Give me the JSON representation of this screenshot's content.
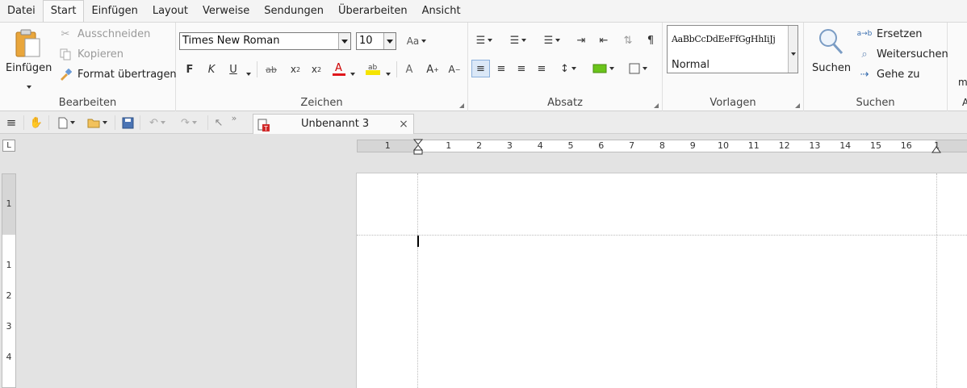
{
  "menu": {
    "items": [
      "Datei",
      "Start",
      "Einfügen",
      "Layout",
      "Verweise",
      "Sendungen",
      "Überarbeiten",
      "Ansicht"
    ],
    "active": "Start"
  },
  "clipboard": {
    "group_label": "Bearbeiten",
    "paste_label": "Einfügen",
    "cut_label": "Ausschneiden",
    "copy_label": "Kopieren",
    "format_painter_label": "Format übertragen"
  },
  "font": {
    "group_label": "Zeichen",
    "font_name": "Times New Roman",
    "font_size": "10",
    "bold_label": "F",
    "italic_label": "K",
    "underline_label": "U"
  },
  "paragraph": {
    "group_label": "Absatz"
  },
  "styles": {
    "group_label": "Vorlagen",
    "preview_text": "AaBbCcDdEeFfGgHhIiJj",
    "current_style": "Normal"
  },
  "search": {
    "group_label": "Suchen",
    "search_label": "Suchen",
    "replace_label": "Ersetzen",
    "find_next_label": "Weitersuchen",
    "goto_label": "Gehe zu",
    "replace_icon_text": "a→b"
  },
  "overflow": {
    "text_1": "m",
    "text_2": "A"
  },
  "document_tab": {
    "title": "Unbenannt 3"
  },
  "ruler": {
    "h_numbers": [
      "1",
      "1",
      "2",
      "3",
      "4",
      "5",
      "6",
      "7",
      "8",
      "9",
      "10",
      "11",
      "12",
      "13",
      "14",
      "15",
      "16",
      "1"
    ],
    "v_numbers": [
      "1",
      "1",
      "2",
      "3",
      "4"
    ]
  },
  "colors": {
    "font_color": "#e0161b",
    "highlight_color": "#f5e400",
    "shading_color": "#6ac41a",
    "paste_icon": "#e9a63c"
  }
}
